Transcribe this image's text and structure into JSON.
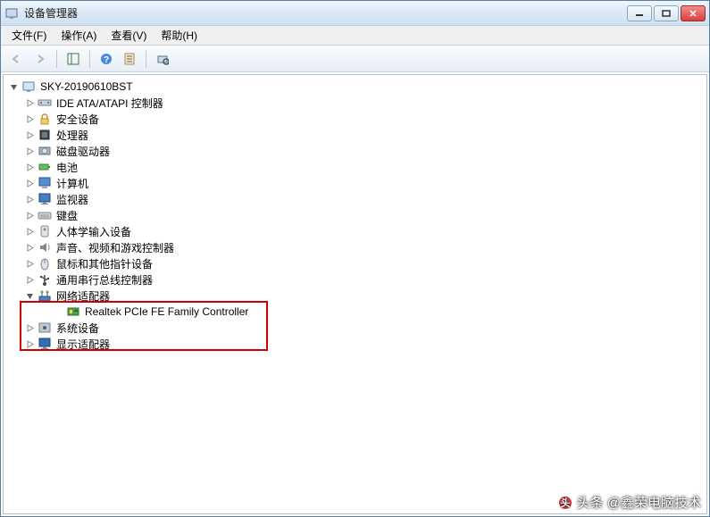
{
  "title": "设备管理器",
  "menus": {
    "file": "文件(F)",
    "action": "操作(A)",
    "view": "查看(V)",
    "help": "帮助(H)"
  },
  "tree": {
    "root": "SKY-20190610BST",
    "categories": [
      {
        "label": "IDE ATA/ATAPI 控制器",
        "icon": "ide"
      },
      {
        "label": "安全设备",
        "icon": "security"
      },
      {
        "label": "处理器",
        "icon": "cpu"
      },
      {
        "label": "磁盘驱动器",
        "icon": "disk"
      },
      {
        "label": "电池",
        "icon": "battery"
      },
      {
        "label": "计算机",
        "icon": "computer"
      },
      {
        "label": "监视器",
        "icon": "monitor"
      },
      {
        "label": "键盘",
        "icon": "keyboard"
      },
      {
        "label": "人体学输入设备",
        "icon": "hid"
      },
      {
        "label": "声音、视频和游戏控制器",
        "icon": "sound"
      },
      {
        "label": "鼠标和其他指针设备",
        "icon": "mouse"
      },
      {
        "label": "通用串行总线控制器",
        "icon": "usb"
      },
      {
        "label": "网络适配器",
        "icon": "network",
        "expanded": true,
        "children": [
          {
            "label": "Realtek PCIe FE Family Controller",
            "icon": "nic"
          }
        ]
      },
      {
        "label": "系统设备",
        "icon": "system"
      },
      {
        "label": "显示适配器",
        "icon": "display"
      }
    ]
  },
  "watermark": "头条 @鑫荣电脑技术"
}
